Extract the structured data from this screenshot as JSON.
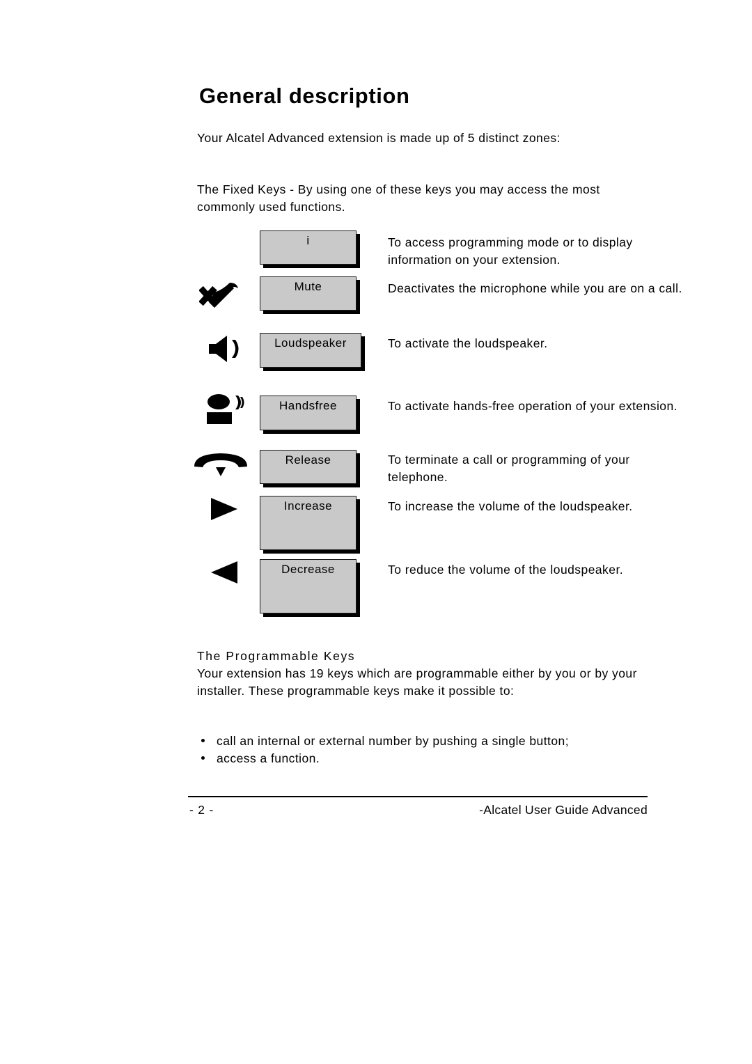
{
  "document": {
    "page_title": "General description",
    "intro_paragraph": "Your Alcatel Advanced extension is made up of 5 distinct zones:",
    "fixed_keys_paragraph": "The Fixed Keys - By using one of these keys you may access the most commonly used functions."
  },
  "fixed_keys": [
    {
      "icon": "none",
      "button_label": "i",
      "description": "To access programming mode or to display information on your extension."
    },
    {
      "icon": "mute-crossed-handset-icon",
      "button_label": "Mute",
      "description": "Deactivates the microphone while you are on a call."
    },
    {
      "icon": "loudspeaker-icon",
      "button_label": "Loudspeaker",
      "description": "To activate the loudspeaker."
    },
    {
      "icon": "handsfree-person-icon",
      "button_label": "Handsfree",
      "description": "To activate hands-free operation of your extension."
    },
    {
      "icon": "release-handset-icon",
      "button_label": "Release",
      "description": "To terminate a call or programming of your telephone."
    },
    {
      "icon": "triangle-right-icon",
      "button_label": "Increase",
      "description": "To increase the volume of the loudspeaker."
    },
    {
      "icon": "triangle-left-icon",
      "button_label": "Decrease",
      "description": "To reduce the volume of the loudspeaker."
    }
  ],
  "programmable_keys": {
    "heading": "The Programmable Keys",
    "body": "Your extension has 19 keys which are programmable either by you or by your installer.  These programmable keys make it possible to:",
    "bullets": [
      "call an internal or external number by pushing a single button;",
      "access a function."
    ]
  },
  "footer": {
    "page_number": "- 2 -",
    "guide_title": "-Alcatel User Guide Advanced"
  },
  "colors": {
    "key_fill": "#c9c9c9",
    "key_border": "#1a1a1a",
    "key_shadow": "#000000",
    "text": "#000000",
    "background": "#ffffff"
  }
}
